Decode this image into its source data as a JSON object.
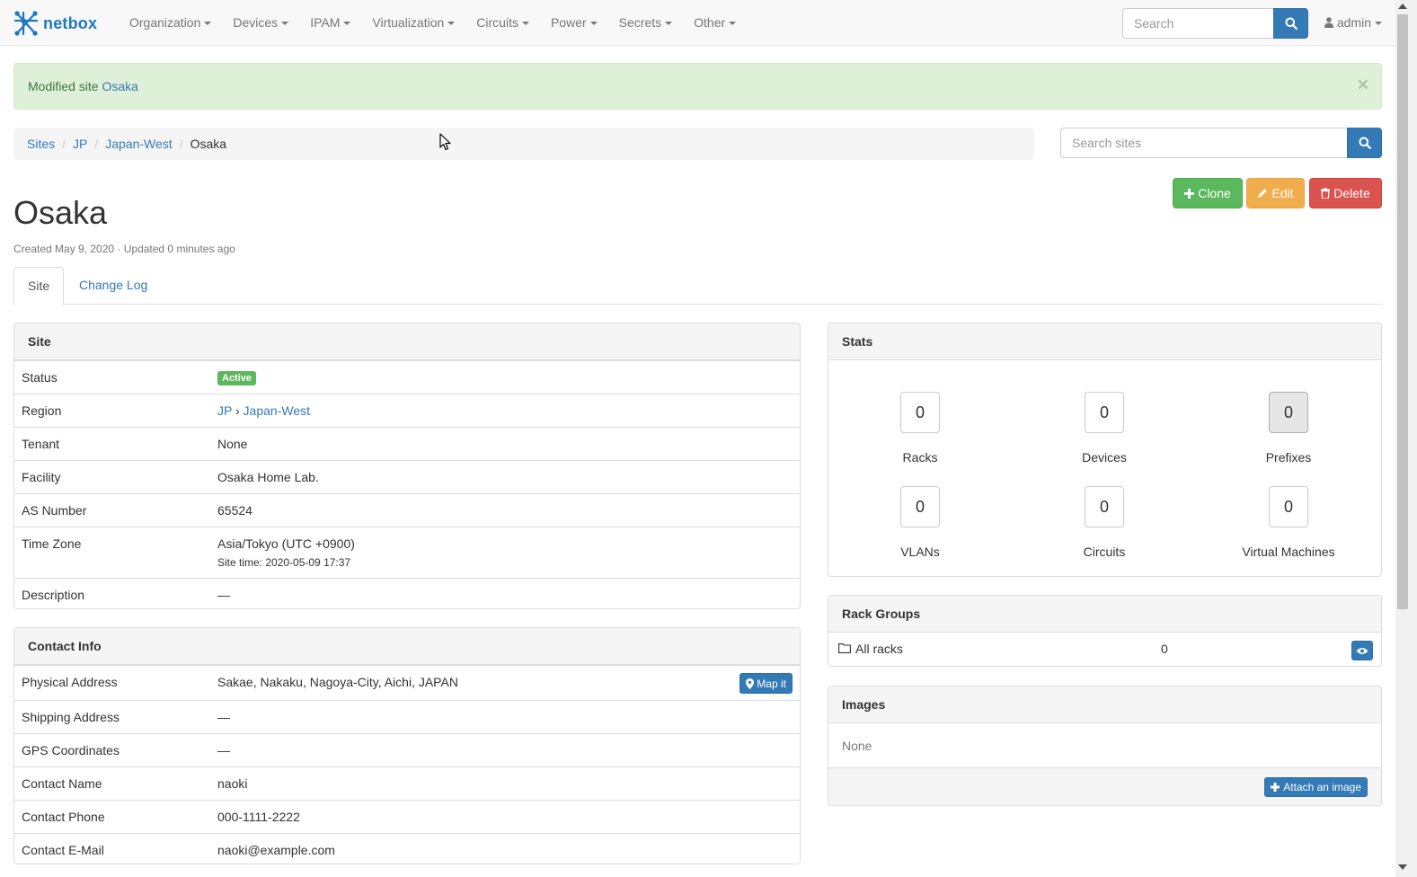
{
  "navbar": {
    "brand": "netbox",
    "menu": [
      "Organization",
      "Devices",
      "IPAM",
      "Virtualization",
      "Circuits",
      "Power",
      "Secrets",
      "Other"
    ],
    "search_placeholder": "Search",
    "user": "admin"
  },
  "alert": {
    "prefix": "Modified site",
    "site_link": "Osaka",
    "close": "×"
  },
  "breadcrumb": {
    "items": [
      "Sites",
      "JP",
      "Japan-West"
    ],
    "active": "Osaka"
  },
  "site_search_placeholder": "Search sites",
  "actions": {
    "clone": "Clone",
    "edit": "Edit",
    "delete": "Delete"
  },
  "title": "Osaka",
  "meta": "Created May 9, 2020 · Updated 0 minutes ago",
  "tabs": {
    "site": "Site",
    "changelog": "Change Log"
  },
  "site_panel": {
    "heading": "Site",
    "status_label": "Status",
    "status": "Active",
    "region_label": "Region",
    "region_parent": "JP",
    "region_sep": "›",
    "region": "Japan-West",
    "tenant_label": "Tenant",
    "tenant": "None",
    "facility_label": "Facility",
    "facility": "Osaka Home Lab.",
    "asn_label": "AS Number",
    "asn": "65524",
    "tz_label": "Time Zone",
    "tz": "Asia/Tokyo (UTC +0900)",
    "site_time": "Site time: 2020-05-09 17:37",
    "desc_label": "Description",
    "desc": "—"
  },
  "contact_panel": {
    "heading": "Contact Info",
    "physical_label": "Physical Address",
    "physical": "Sakae, Nakaku, Nagoya-City, Aichi, JAPAN",
    "map_button": "Map it",
    "shipping_label": "Shipping Address",
    "shipping": "—",
    "gps_label": "GPS Coordinates",
    "gps": "—",
    "name_label": "Contact Name",
    "name": "naoki",
    "phone_label": "Contact Phone",
    "phone": "000-1111-2222",
    "email_label": "Contact E-Mail",
    "email": "naoki@example.com"
  },
  "stats": {
    "heading": "Stats",
    "items": [
      {
        "count": "0",
        "label": "Racks"
      },
      {
        "count": "0",
        "label": "Devices"
      },
      {
        "count": "0",
        "label": "Prefixes"
      },
      {
        "count": "0",
        "label": "VLANs"
      },
      {
        "count": "0",
        "label": "Circuits"
      },
      {
        "count": "0",
        "label": "Virtual Machines"
      }
    ]
  },
  "rack_groups": {
    "heading": "Rack Groups",
    "name": "All racks",
    "count": "0"
  },
  "images": {
    "heading": "Images",
    "none": "None",
    "attach_button": "Attach an image"
  }
}
